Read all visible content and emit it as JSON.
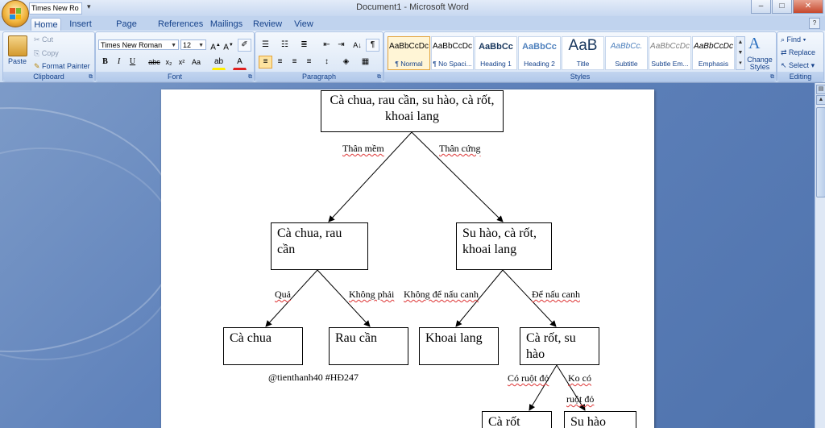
{
  "window": {
    "title": "Document1 - Microsoft Word",
    "qat_font": "Times New Ro",
    "minimize": "–",
    "maximize": "□",
    "close": "✕"
  },
  "tabs": [
    "Home",
    "Insert",
    "Page Layout",
    "References",
    "Mailings",
    "Review",
    "View"
  ],
  "clipboard": {
    "paste": "Paste",
    "cut": "Cut",
    "copy": "Copy",
    "format_painter": "Format Painter",
    "label": "Clipboard"
  },
  "font": {
    "family": "Times New Roman",
    "size": "12",
    "label": "Font"
  },
  "paragraph": {
    "label": "Paragraph"
  },
  "styles": {
    "label": "Styles",
    "items": [
      {
        "sample": "AaBbCcDc",
        "name": "¶ Normal"
      },
      {
        "sample": "AaBbCcDc",
        "name": "¶ No Spaci..."
      },
      {
        "sample": "AaBbCc",
        "name": "Heading 1"
      },
      {
        "sample": "AaBbCc",
        "name": "Heading 2"
      },
      {
        "sample": "AaB",
        "name": "Title"
      },
      {
        "sample": "AaBbCc.",
        "name": "Subtitle"
      },
      {
        "sample": "AaBbCcDc",
        "name": "Subtle Em..."
      },
      {
        "sample": "AaBbCcDc",
        "name": "Emphasis"
      }
    ],
    "change_styles": "Change Styles"
  },
  "editing": {
    "find": "Find",
    "replace": "Replace",
    "select": "Select",
    "label": "Editing"
  },
  "diagram": {
    "root": "Cà chua, rau cần, su hào, cà rốt, khoai lang",
    "left": "Cà chua, rau cần",
    "right": "Su hào, cà rốt, khoai lang",
    "leaf1": "Cà chua",
    "leaf2": "Rau cần",
    "leaf3": "Khoai lang",
    "mid4": "Cà rốt, su hào",
    "leaf5": "Cà rốt",
    "leaf6": "Su hào",
    "edge_than_mem": "Thân mềm",
    "edge_than_cung": "Thân cứng",
    "edge_qua": "Quả",
    "edge_khong_phai": "Không phải",
    "edge_khong_de": "Không để nấu canh",
    "edge_de": "Để nấu canh",
    "edge_co_ruot": "Có ruột đỏ",
    "edge_ko_co": "Ko có",
    "edge_ruot_do": "ruột đỏ",
    "watermark": "@tienthanh40 #HĐ247"
  }
}
